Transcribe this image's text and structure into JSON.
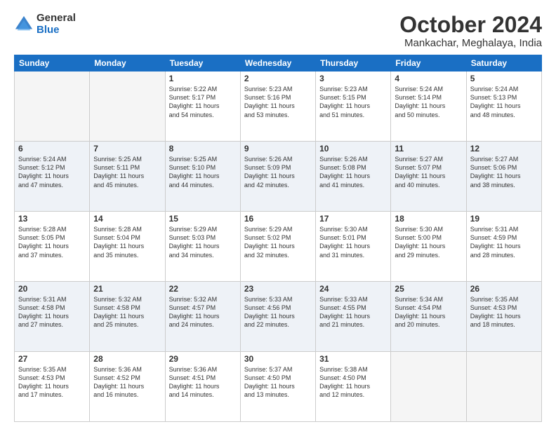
{
  "logo": {
    "general": "General",
    "blue": "Blue"
  },
  "header": {
    "title": "October 2024",
    "subtitle": "Mankachar, Meghalaya, India"
  },
  "days_header": [
    "Sunday",
    "Monday",
    "Tuesday",
    "Wednesday",
    "Thursday",
    "Friday",
    "Saturday"
  ],
  "weeks": [
    [
      {
        "day": "",
        "info": "",
        "empty": true
      },
      {
        "day": "",
        "info": "",
        "empty": true
      },
      {
        "day": "1",
        "info": "Sunrise: 5:22 AM\nSunset: 5:17 PM\nDaylight: 11 hours\nand 54 minutes.",
        "empty": false
      },
      {
        "day": "2",
        "info": "Sunrise: 5:23 AM\nSunset: 5:16 PM\nDaylight: 11 hours\nand 53 minutes.",
        "empty": false
      },
      {
        "day": "3",
        "info": "Sunrise: 5:23 AM\nSunset: 5:15 PM\nDaylight: 11 hours\nand 51 minutes.",
        "empty": false
      },
      {
        "day": "4",
        "info": "Sunrise: 5:24 AM\nSunset: 5:14 PM\nDaylight: 11 hours\nand 50 minutes.",
        "empty": false
      },
      {
        "day": "5",
        "info": "Sunrise: 5:24 AM\nSunset: 5:13 PM\nDaylight: 11 hours\nand 48 minutes.",
        "empty": false
      }
    ],
    [
      {
        "day": "6",
        "info": "Sunrise: 5:24 AM\nSunset: 5:12 PM\nDaylight: 11 hours\nand 47 minutes.",
        "empty": false
      },
      {
        "day": "7",
        "info": "Sunrise: 5:25 AM\nSunset: 5:11 PM\nDaylight: 11 hours\nand 45 minutes.",
        "empty": false
      },
      {
        "day": "8",
        "info": "Sunrise: 5:25 AM\nSunset: 5:10 PM\nDaylight: 11 hours\nand 44 minutes.",
        "empty": false
      },
      {
        "day": "9",
        "info": "Sunrise: 5:26 AM\nSunset: 5:09 PM\nDaylight: 11 hours\nand 42 minutes.",
        "empty": false
      },
      {
        "day": "10",
        "info": "Sunrise: 5:26 AM\nSunset: 5:08 PM\nDaylight: 11 hours\nand 41 minutes.",
        "empty": false
      },
      {
        "day": "11",
        "info": "Sunrise: 5:27 AM\nSunset: 5:07 PM\nDaylight: 11 hours\nand 40 minutes.",
        "empty": false
      },
      {
        "day": "12",
        "info": "Sunrise: 5:27 AM\nSunset: 5:06 PM\nDaylight: 11 hours\nand 38 minutes.",
        "empty": false
      }
    ],
    [
      {
        "day": "13",
        "info": "Sunrise: 5:28 AM\nSunset: 5:05 PM\nDaylight: 11 hours\nand 37 minutes.",
        "empty": false
      },
      {
        "day": "14",
        "info": "Sunrise: 5:28 AM\nSunset: 5:04 PM\nDaylight: 11 hours\nand 35 minutes.",
        "empty": false
      },
      {
        "day": "15",
        "info": "Sunrise: 5:29 AM\nSunset: 5:03 PM\nDaylight: 11 hours\nand 34 minutes.",
        "empty": false
      },
      {
        "day": "16",
        "info": "Sunrise: 5:29 AM\nSunset: 5:02 PM\nDaylight: 11 hours\nand 32 minutes.",
        "empty": false
      },
      {
        "day": "17",
        "info": "Sunrise: 5:30 AM\nSunset: 5:01 PM\nDaylight: 11 hours\nand 31 minutes.",
        "empty": false
      },
      {
        "day": "18",
        "info": "Sunrise: 5:30 AM\nSunset: 5:00 PM\nDaylight: 11 hours\nand 29 minutes.",
        "empty": false
      },
      {
        "day": "19",
        "info": "Sunrise: 5:31 AM\nSunset: 4:59 PM\nDaylight: 11 hours\nand 28 minutes.",
        "empty": false
      }
    ],
    [
      {
        "day": "20",
        "info": "Sunrise: 5:31 AM\nSunset: 4:58 PM\nDaylight: 11 hours\nand 27 minutes.",
        "empty": false
      },
      {
        "day": "21",
        "info": "Sunrise: 5:32 AM\nSunset: 4:58 PM\nDaylight: 11 hours\nand 25 minutes.",
        "empty": false
      },
      {
        "day": "22",
        "info": "Sunrise: 5:32 AM\nSunset: 4:57 PM\nDaylight: 11 hours\nand 24 minutes.",
        "empty": false
      },
      {
        "day": "23",
        "info": "Sunrise: 5:33 AM\nSunset: 4:56 PM\nDaylight: 11 hours\nand 22 minutes.",
        "empty": false
      },
      {
        "day": "24",
        "info": "Sunrise: 5:33 AM\nSunset: 4:55 PM\nDaylight: 11 hours\nand 21 minutes.",
        "empty": false
      },
      {
        "day": "25",
        "info": "Sunrise: 5:34 AM\nSunset: 4:54 PM\nDaylight: 11 hours\nand 20 minutes.",
        "empty": false
      },
      {
        "day": "26",
        "info": "Sunrise: 5:35 AM\nSunset: 4:53 PM\nDaylight: 11 hours\nand 18 minutes.",
        "empty": false
      }
    ],
    [
      {
        "day": "27",
        "info": "Sunrise: 5:35 AM\nSunset: 4:53 PM\nDaylight: 11 hours\nand 17 minutes.",
        "empty": false
      },
      {
        "day": "28",
        "info": "Sunrise: 5:36 AM\nSunset: 4:52 PM\nDaylight: 11 hours\nand 16 minutes.",
        "empty": false
      },
      {
        "day": "29",
        "info": "Sunrise: 5:36 AM\nSunset: 4:51 PM\nDaylight: 11 hours\nand 14 minutes.",
        "empty": false
      },
      {
        "day": "30",
        "info": "Sunrise: 5:37 AM\nSunset: 4:50 PM\nDaylight: 11 hours\nand 13 minutes.",
        "empty": false
      },
      {
        "day": "31",
        "info": "Sunrise: 5:38 AM\nSunset: 4:50 PM\nDaylight: 11 hours\nand 12 minutes.",
        "empty": false
      },
      {
        "day": "",
        "info": "",
        "empty": true
      },
      {
        "day": "",
        "info": "",
        "empty": true
      }
    ]
  ]
}
